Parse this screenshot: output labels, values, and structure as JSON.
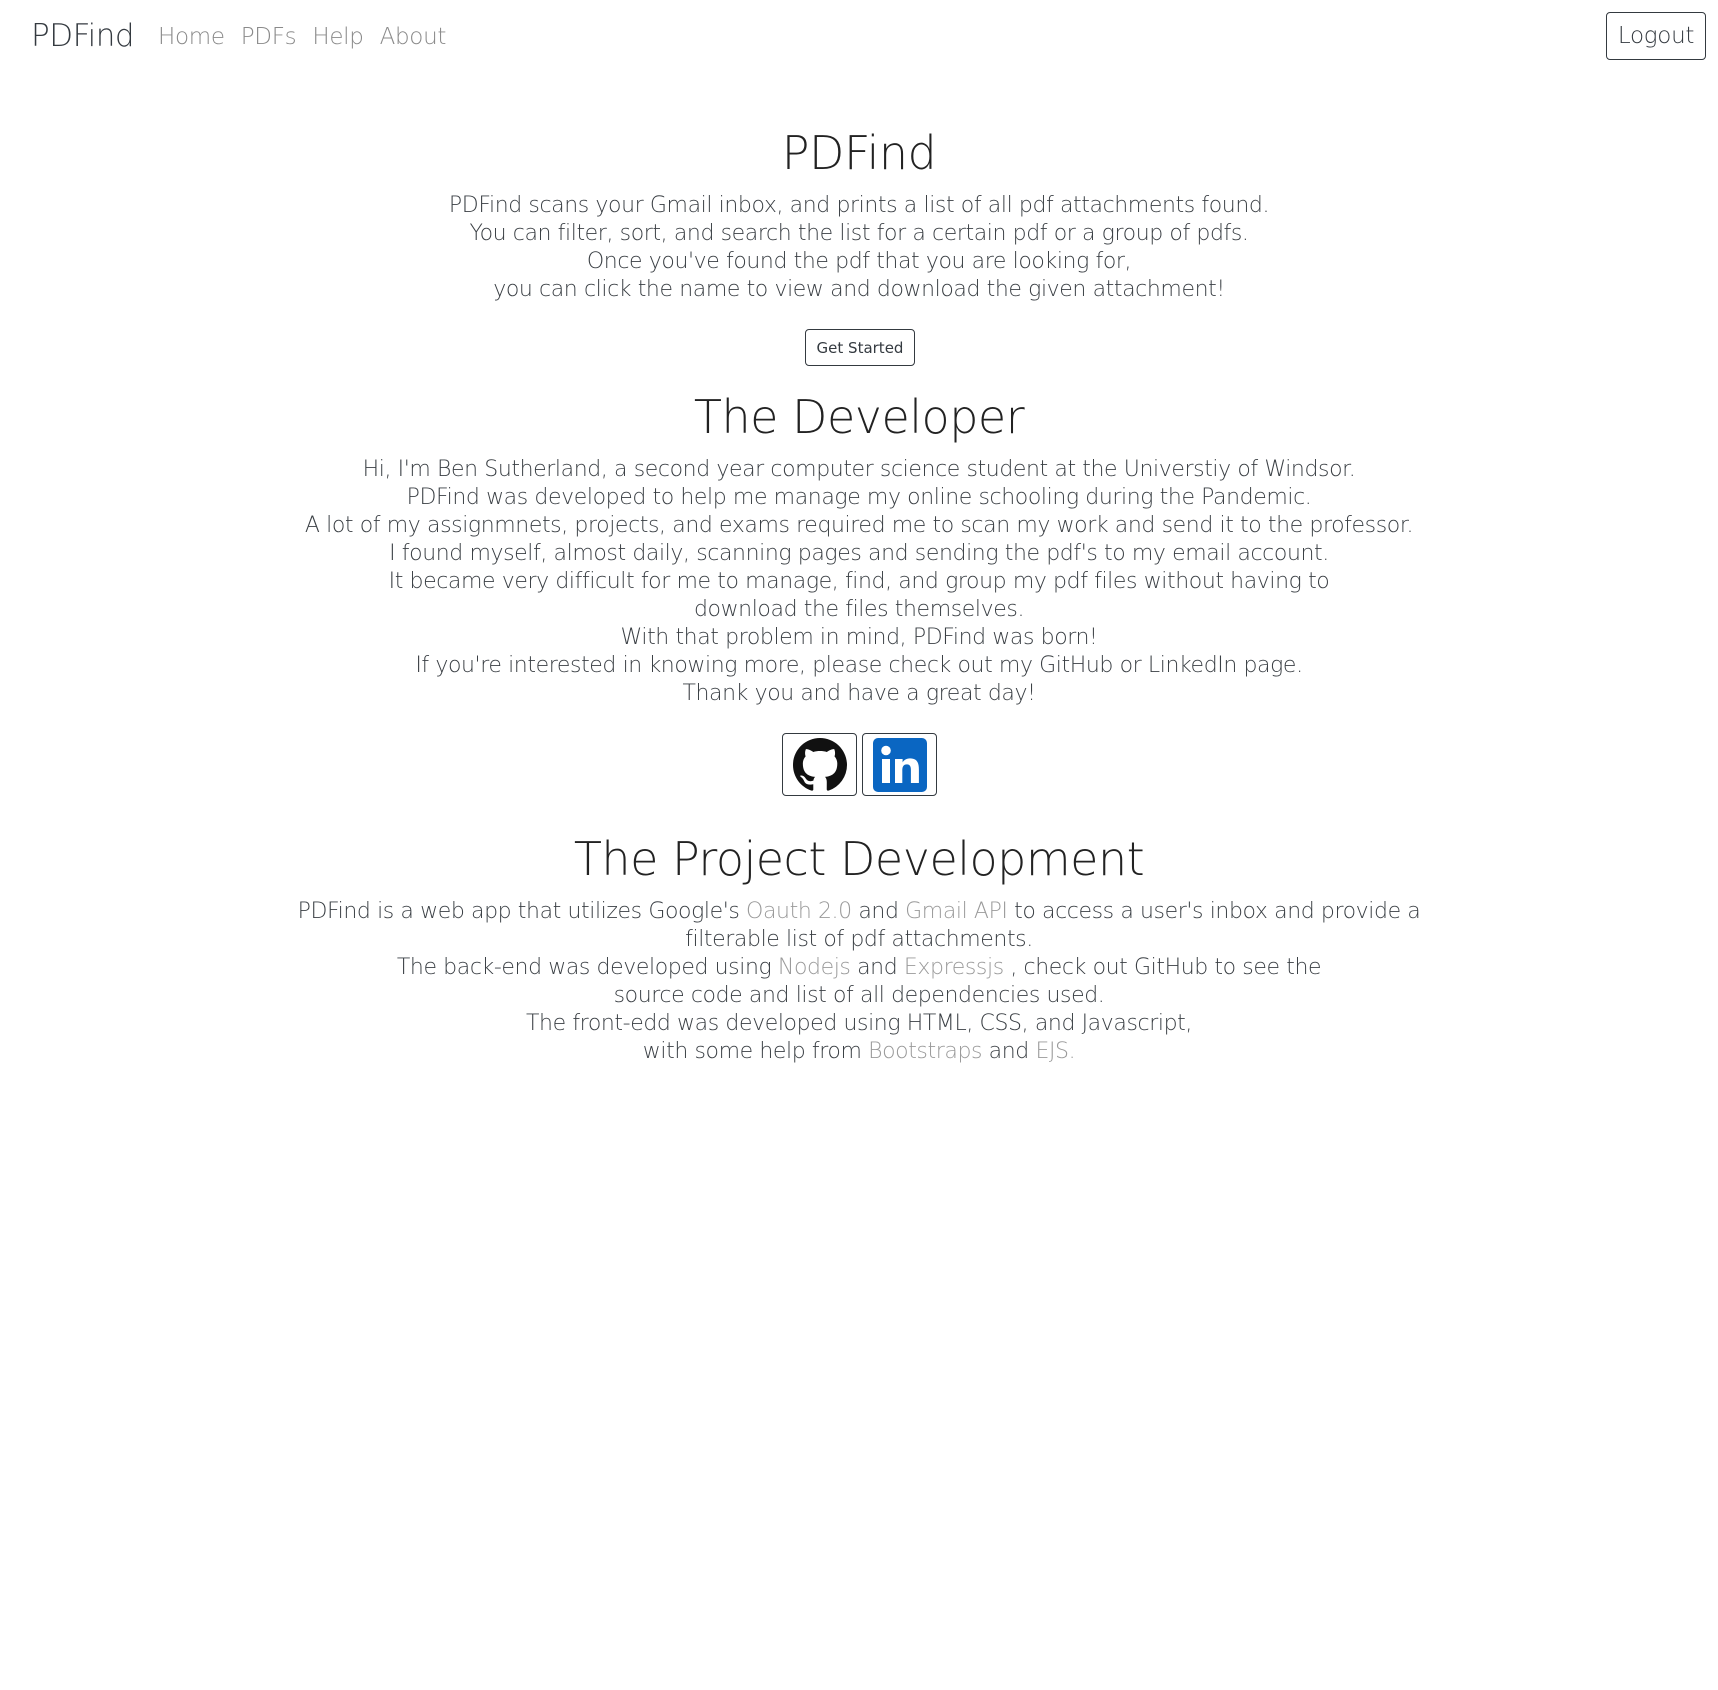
{
  "nav": {
    "brand": "PDFind",
    "links": [
      "Home",
      "PDFs",
      "Help",
      "About"
    ],
    "logout_label": "Logout"
  },
  "intro": {
    "title": "PDFind",
    "lines": [
      "PDFind scans your Gmail inbox, and prints a list of all pdf attachments found.",
      "You can filter, sort, and search the list for a certain pdf or a group of pdfs.",
      "Once you've found the pdf that you are looking for,",
      "you can click the name to view and download the given attachment!"
    ],
    "button_label": "Get Started"
  },
  "developer": {
    "title": "The Developer",
    "lines": [
      "Hi, I'm Ben Sutherland, a second year computer science student at the Universtiy of Windsor.",
      "PDFind was developed to help me manage my online schooling during the Pandemic.",
      "A lot of my assignmnets, projects, and exams required me to scan my work and send it to the professor.",
      "I found myself, almost daily, scanning pages and sending the pdf's to my email account.",
      "It became very difficult for me to manage, find, and group my pdf files without having to",
      "download the files themselves.",
      "With that problem in mind, PDFind was born!",
      "If you're interested in knowing more, please check out my GitHub or LinkedIn page.",
      "Thank you and have a great day!"
    ],
    "social": {
      "github_icon": "github-icon",
      "linkedin_icon": "linkedin-icon",
      "linkedin_color": "#0a66c2"
    }
  },
  "project": {
    "title": "The Project Development",
    "line1": {
      "a": "PDFind is a web app that utilizes Google's ",
      "link1": "Oauth 2.0",
      "b": " and ",
      "link2": "Gmail API",
      "c": " to access a user's inbox and provide a"
    },
    "line2": "filterable list of pdf attachments.",
    "line3": {
      "a": "The back-end was developed using ",
      "link1": "Nodejs",
      "b": " and ",
      "link2": "Expressjs",
      "c": " , check out GitHub to see the"
    },
    "line4": "source code and list of all dependencies used.",
    "line5": "The front-edd was developed using HTML, CSS, and Javascript,",
    "line6": {
      "a": "with some help from ",
      "link1": "Bootstraps",
      "b": " and ",
      "link2": "EJS."
    }
  },
  "colors": {
    "text": "#343a40",
    "muted_link": "#9a9a9a"
  }
}
